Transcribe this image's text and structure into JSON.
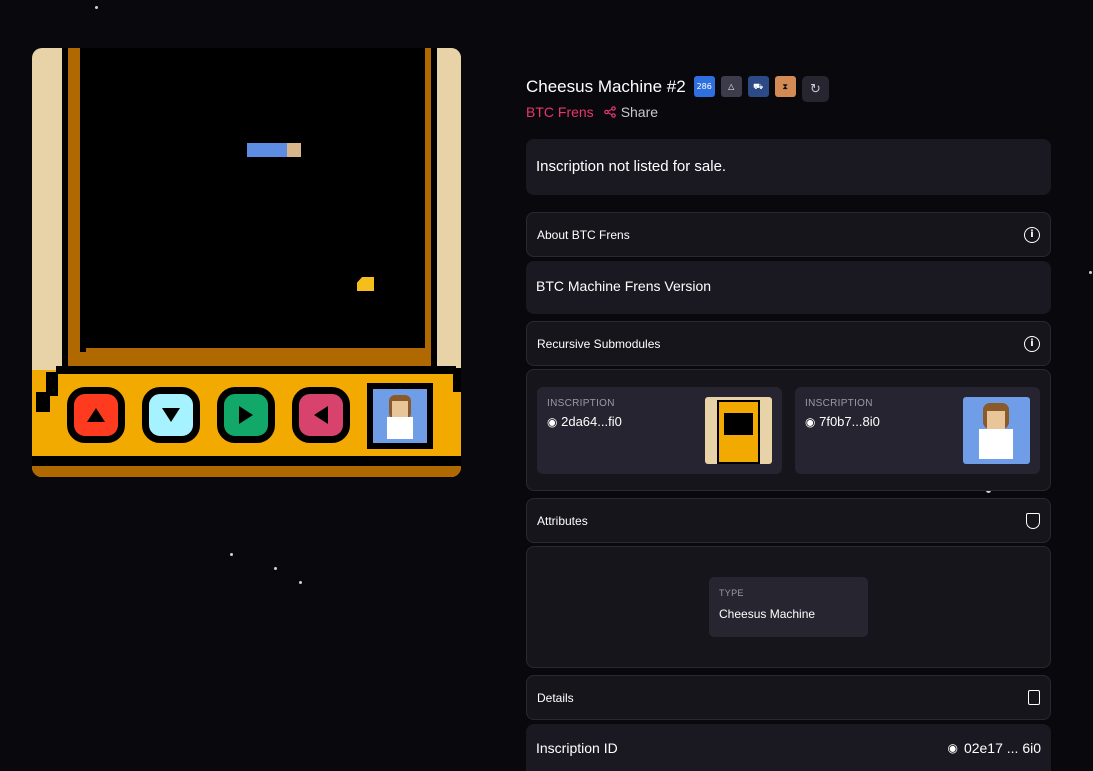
{
  "inscription": {
    "title": "Cheesus Machine #2",
    "badges": [
      {
        "name": "286-badge",
        "text": "286",
        "bg": "#2f6fe0",
        "fg": "#ffffff"
      },
      {
        "name": "pyramid-badge",
        "text": "△",
        "bg": "#3c3c4a",
        "fg": "#ffffff"
      },
      {
        "name": "cart-badge",
        "text": "⛟",
        "bg": "#2c4a86",
        "fg": "#ffffff"
      },
      {
        "name": "hourglass-badge",
        "text": "⧗",
        "bg": "#d38a55",
        "fg": "#111111"
      }
    ],
    "refresh_icon": "↻",
    "collection": "BTC Frens",
    "share_label": "Share",
    "share_icon": "share-icon"
  },
  "listing": {
    "text": "Inscription not listed for sale."
  },
  "about": {
    "header": "About BTC Frens",
    "description": "BTC Machine Frens Version"
  },
  "submodules": {
    "header": "Recursive Submodules",
    "items": [
      {
        "label": "INSCRIPTION",
        "id": "2da64...fi0",
        "icon": "◉"
      },
      {
        "label": "INSCRIPTION",
        "id": "7f0b7...8i0",
        "icon": "◉"
      }
    ]
  },
  "attributes": {
    "header": "Attributes",
    "items": [
      {
        "label": "TYPE",
        "value": "Cheesus Machine"
      }
    ]
  },
  "details": {
    "header": "Details",
    "inscription_id_label": "Inscription ID",
    "inscription_id_value": "02e17 ... 6i0",
    "inscription_id_icon": "◉"
  },
  "colors": {
    "background": "#09080d",
    "card": "#16151c",
    "accent_pink": "#e9366d",
    "cabinet_orange": "#f2a900",
    "cabinet_brown": "#b06800",
    "button_red": "#ff3b1f",
    "button_cyan": "#a6f3ff",
    "button_green": "#12a86a",
    "button_pink": "#d8436e"
  }
}
